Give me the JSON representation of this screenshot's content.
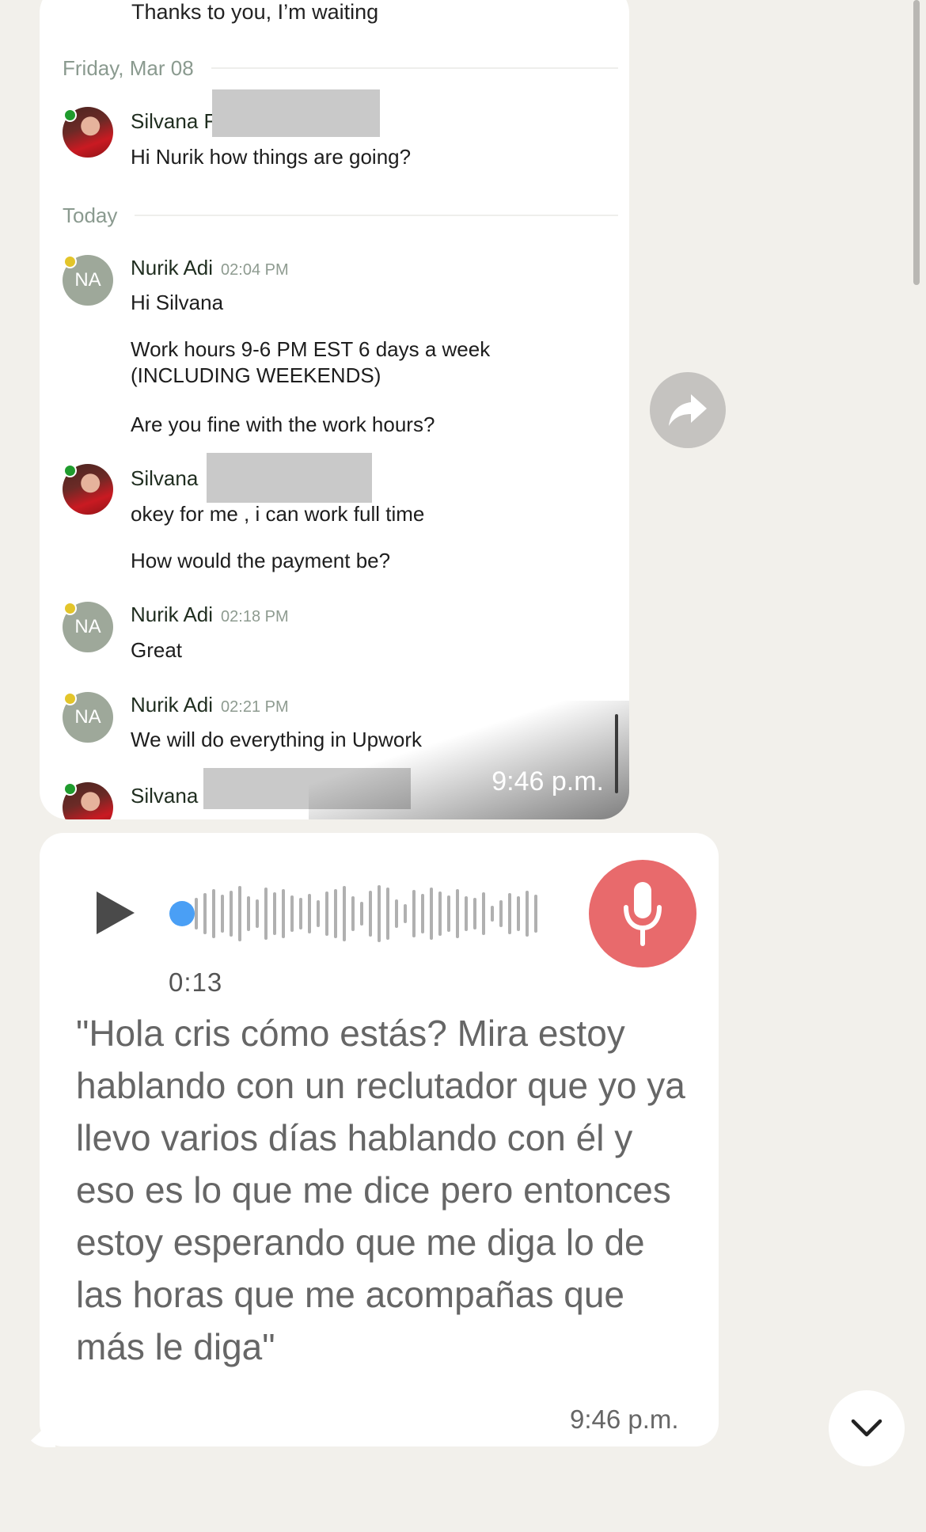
{
  "screenshot": {
    "top_message": "Thanks to you, I’m waiting",
    "date_separators": [
      "Friday, Mar 08",
      "Today"
    ],
    "messages": [
      {
        "name": "Silvana F",
        "time": "",
        "avatar": "photo",
        "status": "online",
        "lines": [
          "Hi Nurik how things are going?"
        ]
      },
      {
        "name": "Nurik Adi",
        "time": "02:04 PM",
        "avatar": "NA",
        "status": "away",
        "lines": [
          "Hi Silvana",
          "Work hours 9-6 PM EST 6 days a week (INCLUDING WEEKENDS)",
          "Are you fine with the work hours?"
        ]
      },
      {
        "name": "Silvana",
        "time": "",
        "avatar": "photo",
        "status": "online",
        "lines": [
          "okey for me , i can work full time",
          "How would the payment be?"
        ]
      },
      {
        "name": "Nurik Adi",
        "time": "02:18 PM",
        "avatar": "NA",
        "status": "away",
        "lines": [
          "Great"
        ]
      },
      {
        "name": "Nurik Adi",
        "time": "02:21 PM",
        "avatar": "NA",
        "status": "away",
        "lines": [
          "We will do everything in Upwork"
        ]
      },
      {
        "name": "Silvana",
        "time": "",
        "avatar": "photo",
        "status": "online",
        "lines": []
      }
    ],
    "avatar_initials": "NA",
    "timestamp": "9:46 p.m."
  },
  "voice_message": {
    "duration": "0:13",
    "transcript": "\"Hola cris cómo estás? Mira estoy hablando con un reclutador que yo ya llevo varios días hablando con él y eso es lo que me dice pero entonces estoy esperando que me diga lo de las horas que me acompañas que más le diga\"",
    "timestamp": "9:46 p.m.",
    "progress": 0
  },
  "icons": {
    "forward": "forward-icon",
    "play": "play-icon",
    "mic": "microphone-icon",
    "scroll_down": "chevron-down-icon"
  },
  "colors": {
    "background": "#f2f0eb",
    "mic_button": "#e86a6c",
    "waveform_progress": "#4a9ff5",
    "online_dot": "#1f9b2d",
    "away_dot": "#e3c52a",
    "avatar_na": "#9ea89a"
  }
}
